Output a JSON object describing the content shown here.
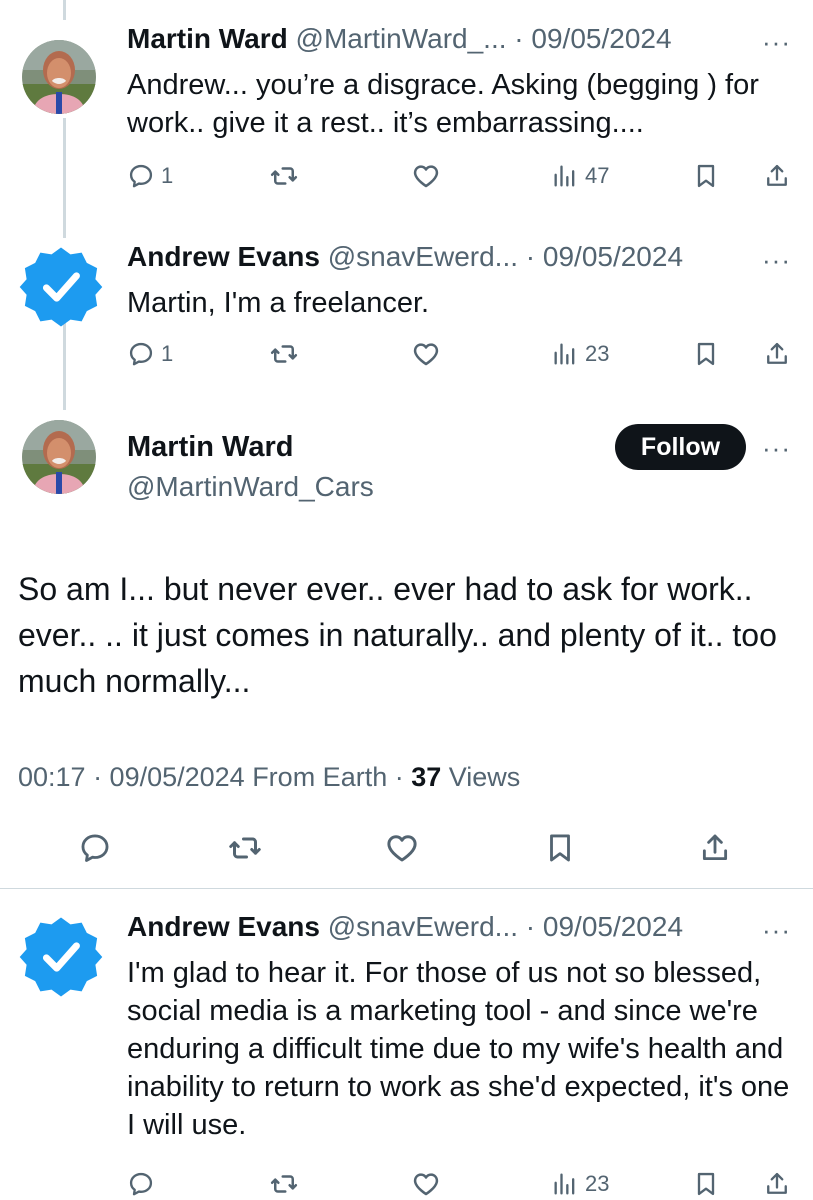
{
  "replies_above": [
    {
      "name": "Martin Ward",
      "handle_date": "@MartinWard_... · 09/05/2024",
      "text": "Andrew... you’re a disgrace. Asking (begging ) for work.. give it a rest.. it’s embarrassing....",
      "reply_count": "1",
      "views": "47"
    },
    {
      "name": "Andrew Evans",
      "handle_date": "@snavEwerd... · 09/05/2024",
      "text": "Martin, I'm a freelancer.",
      "reply_count": "1",
      "views": "23"
    }
  ],
  "main_tweet": {
    "name": "Martin Ward",
    "handle": "@MartinWard_Cars",
    "follow_label": "Follow",
    "text": "So am I... but never ever.. ever had to ask for work.. ever.. .. it just comes in naturally.. and plenty of it.. too much normally...",
    "time_date": "00:17 · 09/05/2024 From Earth · ",
    "views_count": "37",
    "views_label": " Views"
  },
  "reply_below": {
    "name": "Andrew Evans",
    "handle_date": "@snavEwerd... · 09/05/2024",
    "text": "I'm glad to hear it. For those of us not so blessed, social media is a marketing tool - and since we're enduring a difficult time due to my wife's health and inability to return to work as she'd expected, it's one I will use.",
    "views": "23"
  },
  "more_glyph": "···",
  "colors": {
    "text": "#0f1419",
    "secondary": "#536471",
    "verified": "#1d9bf0",
    "button": "#0f1419",
    "divider": "#cfd9de"
  },
  "icons": [
    "reply-icon",
    "retweet-icon",
    "like-icon",
    "views-icon",
    "bookmark-icon",
    "share-icon",
    "verified-badge-icon",
    "more-icon"
  ]
}
